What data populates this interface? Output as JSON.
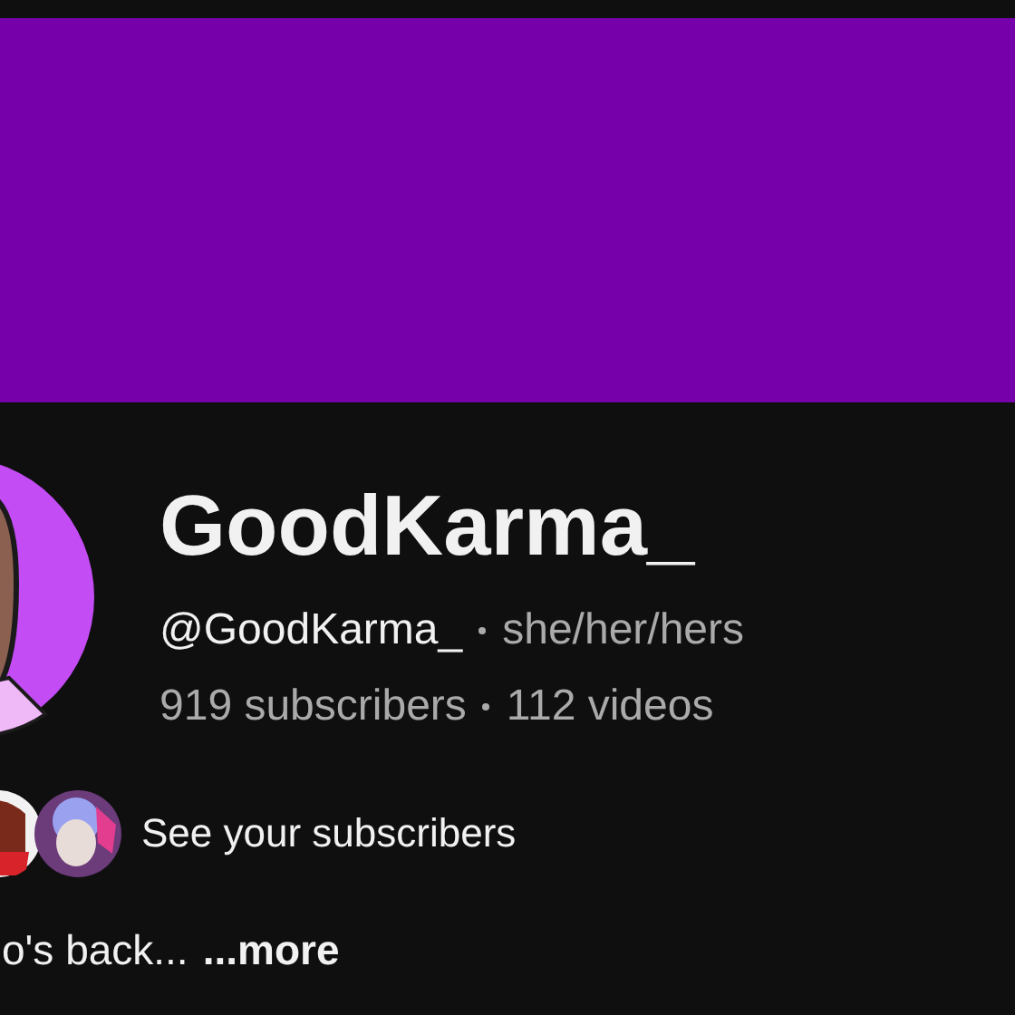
{
  "channel": {
    "name": "GoodKarma_",
    "handle": "@GoodKarma_",
    "pronouns": "she/her/hers",
    "subscribers": "919 subscribers",
    "videos": "112 videos"
  },
  "subscribers_link": {
    "label": "See your subscribers"
  },
  "description": {
    "text": "o's back...",
    "more": "...more"
  }
}
